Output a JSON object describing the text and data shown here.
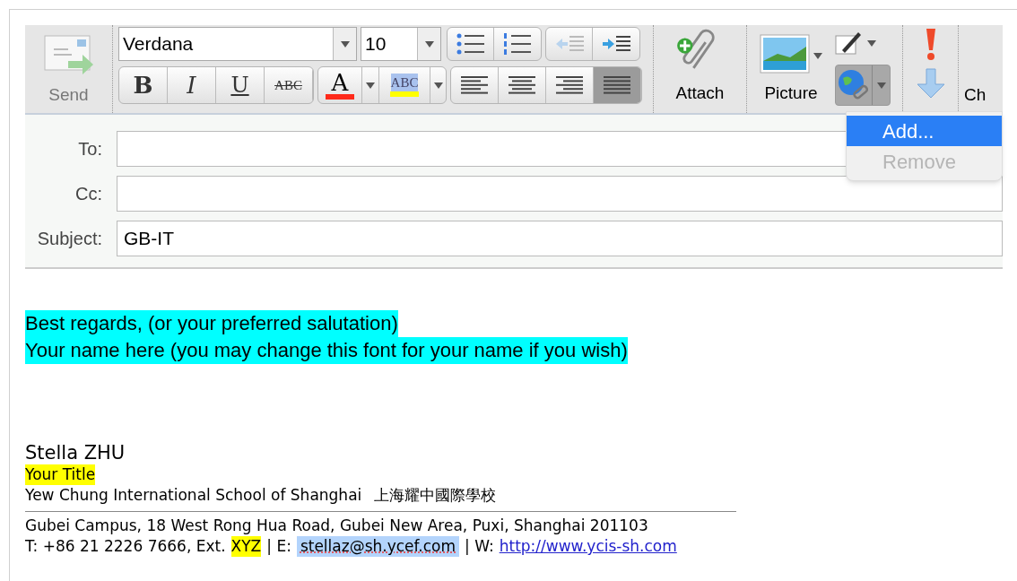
{
  "toolbar": {
    "send_label": "Send",
    "font_name": "Verdana",
    "font_size": "10",
    "format_buttons": [
      {
        "kind": "bold",
        "label": "B"
      },
      {
        "kind": "italic",
        "label": "I"
      },
      {
        "kind": "underline",
        "label": "U"
      },
      {
        "kind": "strike",
        "label": "ABC"
      }
    ],
    "text_color": {
      "label": "A",
      "color": "#ff2a1a"
    },
    "highlight": {
      "label": "ABC",
      "color": "#ffff00"
    },
    "align_buttons": [
      {
        "kind": "left",
        "selected": false
      },
      {
        "kind": "center",
        "selected": false
      },
      {
        "kind": "right",
        "selected": false
      },
      {
        "kind": "justify",
        "selected": true
      }
    ],
    "attach_label": "Attach",
    "picture_label": "Picture",
    "cut_label": "Ch"
  },
  "link_menu": {
    "items": [
      {
        "label": "Add...",
        "selected": true,
        "disabled": false
      },
      {
        "label": "Remove",
        "selected": false,
        "disabled": true
      }
    ]
  },
  "fields": [
    {
      "label": "To:"
    },
    {
      "label": "Cc:"
    },
    {
      "label": "Subject:",
      "value": "GB-IT"
    }
  ],
  "body": [
    {
      "text": "Best regards, (or your preferred salutation)",
      "color": "#00ffff"
    },
    {
      "text": "Your name here (you may change this font for your name if you wish)",
      "color": "#00ffff"
    }
  ],
  "signature": {
    "name": "Stella ZHU",
    "title": {
      "text": "Your Title",
      "color": "#ffff00"
    },
    "school": "Yew Chung International School of Shanghai",
    "school_cn": "上海耀中國際學校",
    "address": "Gubei Campus, 18 West Rong Hua Road, Gubei New Area, Puxi, Shanghai 201103",
    "contact": [
      {
        "kind": "plain",
        "text": "T: +86 21 2226 7666, Ext."
      },
      {
        "kind": "highlight",
        "text": "XYZ",
        "color": "#ffff00"
      },
      {
        "kind": "plain",
        "text": "| E:"
      },
      {
        "kind": "email",
        "text": "stellaz@sh.ycef.com",
        "color": "#b3d4fc"
      },
      {
        "kind": "plain",
        "text": "| W:"
      },
      {
        "kind": "link",
        "text": "http://www.ycis-sh.com"
      }
    ]
  }
}
